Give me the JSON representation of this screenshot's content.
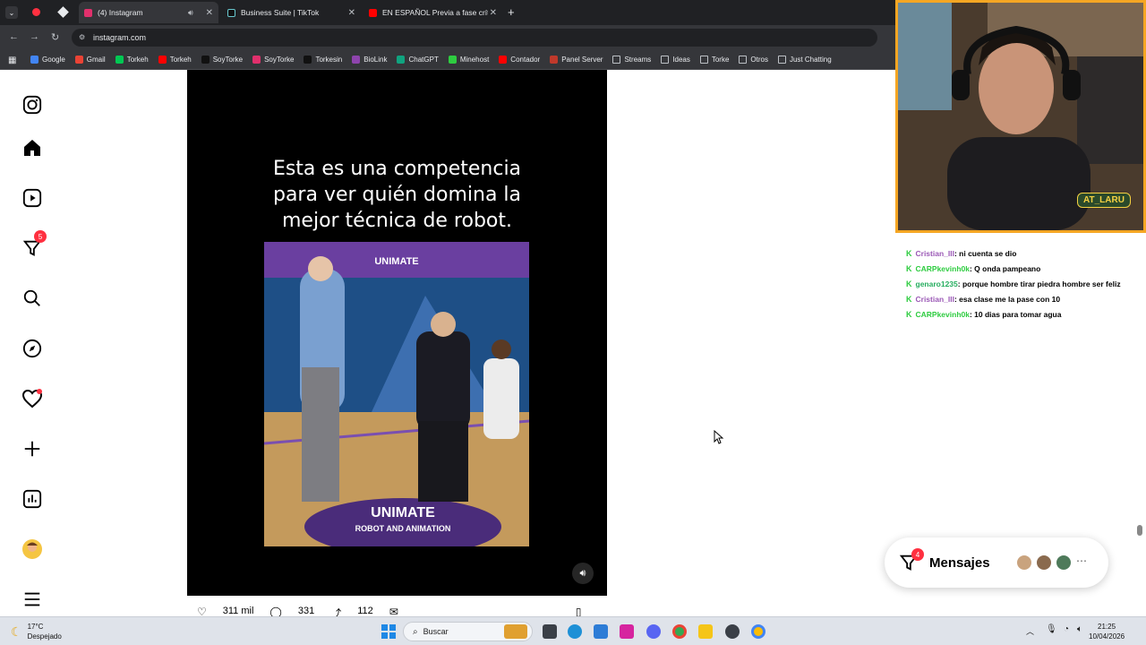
{
  "browser": {
    "tabs": [
      {
        "label": "(4) Instagram",
        "active": true,
        "color": "#e1306c"
      },
      {
        "label": "Business Suite | TikTok",
        "active": false,
        "color": "#111111"
      },
      {
        "label": "EN ESPAÑOL Previa a fase crític",
        "active": false,
        "color": "#ff0000"
      }
    ],
    "url": "instagram.com",
    "bookmarks": [
      {
        "label": "Google",
        "color": "#4285f4"
      },
      {
        "label": "Gmail",
        "color": "#ea4335"
      },
      {
        "label": "Torkeh",
        "color": "#00c853"
      },
      {
        "label": "Torkeh",
        "color": "#ff0000"
      },
      {
        "label": "SoyTorke",
        "color": "#111111"
      },
      {
        "label": "SoyTorke",
        "color": "#e1306c"
      },
      {
        "label": "Torkesin",
        "color": "#111111"
      },
      {
        "label": "BioLink",
        "color": "#8e44ad"
      },
      {
        "label": "ChatGPT",
        "color": "#10a37f"
      },
      {
        "label": "Minehost",
        "color": "#2ecc40"
      },
      {
        "label": "Contador",
        "color": "#ff0000"
      },
      {
        "label": "Panel Server",
        "color": "#c0392b"
      },
      {
        "label": "Streams",
        "color": "folder"
      },
      {
        "label": "Ideas",
        "color": "folder"
      },
      {
        "label": "Torke",
        "color": "folder"
      },
      {
        "label": "Otros",
        "color": "folder"
      },
      {
        "label": "Just Chatting",
        "color": "folder"
      }
    ]
  },
  "instagram": {
    "sidebar": {
      "notifications_badge": "5"
    },
    "post": {
      "caption_overlay": "Esta es una competencia para ver quién domina la mejor técnica de robot.",
      "video_banner_top": "UNIMATE",
      "video_floor_text": "UNIMATE",
      "video_floor_sub": "ROBOT AND ANIMATION",
      "likes_partial": "311 mil",
      "comments_partial": "331",
      "shares_partial": "112"
    },
    "messages": {
      "label": "Mensajes",
      "badge": "4"
    }
  },
  "stream": {
    "cam_badge": "AT_LARU",
    "chat": [
      {
        "user": "Cristian_III",
        "user_color": "#9b59b6",
        "text": ": ni cuenta se dio"
      },
      {
        "user": "CARPkevinh0k",
        "user_color": "#2ecc40",
        "text": ": Q onda pampeano"
      },
      {
        "user": "genaro1235",
        "user_color": "#27ae60",
        "text": ": porque hombre tirar piedra hombre ser feliz"
      },
      {
        "user": "Cristian_III",
        "user_color": "#9b59b6",
        "text": ": esa clase me la pase con 10"
      },
      {
        "user": "CARPkevinh0k",
        "user_color": "#2ecc40",
        "text": ": 10 dias para tomar agua"
      }
    ]
  },
  "taskbar": {
    "weather_temp": "17°C",
    "weather_desc": "Despejado",
    "search_label": "Buscar",
    "time": "21:25",
    "date": "10/04/2026"
  }
}
